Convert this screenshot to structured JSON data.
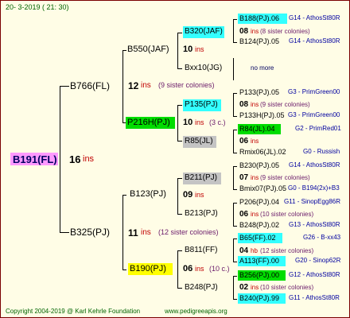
{
  "header": {
    "date": "20-  3-2019 (  21:  30)"
  },
  "colors": {
    "cyan": "#33ffff",
    "green": "#00dd00",
    "yellow": "#ffff00",
    "pink": "#ff99ff",
    "gray": "#c4c4c4",
    "dark_red": "#7a0000"
  },
  "root": {
    "id": "B191(FL)",
    "value": "16",
    "ins": "ins"
  },
  "gen2": [
    {
      "id": "B766(FL)",
      "value": "12",
      "ins": "ins",
      "note": "(9 sister colonies)"
    },
    {
      "id": "B325(PJ)",
      "value": "11",
      "ins": "ins",
      "note": "(12 sister colonies)"
    }
  ],
  "gen3": [
    {
      "id": "B550(JAF)",
      "value": "10",
      "ins": "ins"
    },
    {
      "id": "P216H(PJ)",
      "value": "10",
      "ins": "ins",
      "note": "(3 c.)"
    },
    {
      "id": "B123(PJ)",
      "value": "09",
      "ins": "ins"
    },
    {
      "id": "B190(PJ)",
      "value": "06",
      "ins": "ins",
      "note": "(10 c.)"
    }
  ],
  "gen4": [
    {
      "id": "B320(JAF)",
      "value": "08",
      "ins": "ins",
      "note": "(8 sister colonies)"
    },
    {
      "id": "Bxx10(JG)",
      "note": "no more"
    },
    {
      "id": "P135(PJ)",
      "value": "08",
      "ins": "ins",
      "note": "(9 sister colonies)"
    },
    {
      "id": "R85(JL)",
      "value": "06",
      "ins": "ins"
    },
    {
      "id": "B211(PJ)",
      "value": "07",
      "ins": "ins",
      "note": "(9 sister colonies)"
    },
    {
      "id": "B213(PJ)",
      "value": "06",
      "ins": "ins",
      "note": "(10 sister colonies)"
    },
    {
      "id": "B811(FF)",
      "value": "04",
      "ins": "hb",
      "note": "(12 sister colonies)"
    },
    {
      "id": "B248(PJ)",
      "value": "02",
      "ins": "ins",
      "note": "(10 sister colonies)"
    }
  ],
  "gen5": [
    {
      "id": "B188(PJ).06",
      "detail": "G14 - AthosSt80R"
    },
    {
      "id": "B124(PJ).05",
      "detail": "G14 - AthosSt80R"
    },
    {
      "id": "P133(PJ).05",
      "detail": "G3 - PrimGreen00"
    },
    {
      "id": "P133H(PJ).05",
      "detail": "G3 - PrimGreen00"
    },
    {
      "id": "R84(JL).04",
      "detail": "G2 - PrimRed01"
    },
    {
      "id": "Rmix06(JL).02",
      "detail": "G0 - Russish"
    },
    {
      "id": "B230(PJ).05",
      "detail": "G14 - AthosSt80R"
    },
    {
      "id": "Bmix07(PJ).05",
      "detail": "G0 - B194(2x)+B3"
    },
    {
      "id": "P206(PJ).04",
      "detail": "G11 - SinopEgg86R"
    },
    {
      "id": "B248(PJ).02",
      "detail": "G13 - AthosSt80R"
    },
    {
      "id": "B65(FF).02",
      "detail": "G26 - B-xx43"
    },
    {
      "id": "A113(FF).00",
      "detail": "G20 - Sinop62R"
    },
    {
      "id": "B256(PJ).00",
      "detail": "G12 - AthosSt80R"
    },
    {
      "id": "B240(PJ).99",
      "detail": "G11 - AthosSt80R"
    }
  ],
  "footer": {
    "copyright": "Copyright 2004-2019 @ Karl Kehrle Foundation",
    "site": "www.pedigreeapis.org"
  }
}
